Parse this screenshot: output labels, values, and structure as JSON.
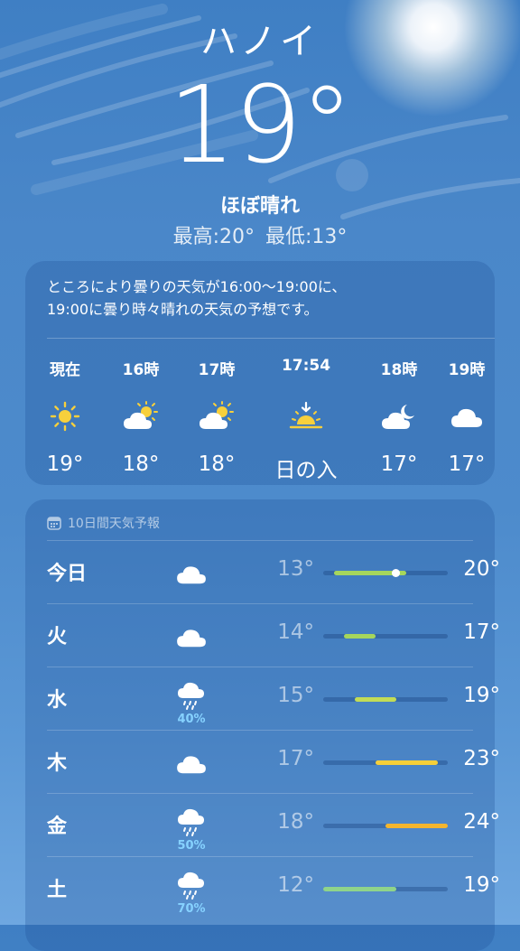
{
  "location": {
    "city": "ハノイ",
    "temperature": "19°",
    "condition": "ほぼ晴れ",
    "high": "最高:20°",
    "low": "最低:13°"
  },
  "hourly": {
    "summary_line1": "ところにより曇りの天気が16:00～19:00に、",
    "summary_line2": "19:00に曇り時々晴れの天気の予想です。",
    "items": [
      {
        "time": "現在",
        "icon": "sun-icon",
        "temp": "19°"
      },
      {
        "time": "16時",
        "icon": "partly-cloudy-icon",
        "temp": "18°"
      },
      {
        "time": "17時",
        "icon": "partly-cloudy-icon",
        "temp": "18°"
      },
      {
        "time": "17:54",
        "icon": "sunset-icon",
        "temp": "日の入"
      },
      {
        "time": "18時",
        "icon": "cloudy-night-icon",
        "temp": "17°"
      },
      {
        "time": "19時",
        "icon": "cloud-icon",
        "temp": "17°"
      }
    ]
  },
  "daily": {
    "header": "10日間天気予報",
    "scale": {
      "min": 12,
      "max": 24
    },
    "rows": [
      {
        "day": "今日",
        "icon": "cloud-icon",
        "precip": "",
        "low": "13°",
        "high": "20°",
        "low_value": 13,
        "high_value": 20,
        "current_value": 19,
        "color": "#a6d65c"
      },
      {
        "day": "火",
        "icon": "cloud-icon",
        "precip": "",
        "low": "14°",
        "high": "17°",
        "low_value": 14,
        "high_value": 17,
        "color": "#a6d65c"
      },
      {
        "day": "水",
        "icon": "rain-icon",
        "precip": "40%",
        "low": "15°",
        "high": "19°",
        "low_value": 15,
        "high_value": 19,
        "color": "#c2dc56"
      },
      {
        "day": "木",
        "icon": "cloud-icon",
        "precip": "",
        "low": "17°",
        "high": "23°",
        "low_value": 17,
        "high_value": 23,
        "color": "#f5cf3a"
      },
      {
        "day": "金",
        "icon": "rain-icon",
        "precip": "50%",
        "low": "18°",
        "high": "24°",
        "low_value": 18,
        "high_value": 24,
        "color": "#f4b52e"
      },
      {
        "day": "土",
        "icon": "rain-icon",
        "precip": "70%",
        "low": "12°",
        "high": "19°",
        "low_value": 12,
        "high_value": 19,
        "color": "#8fd48a"
      }
    ]
  }
}
